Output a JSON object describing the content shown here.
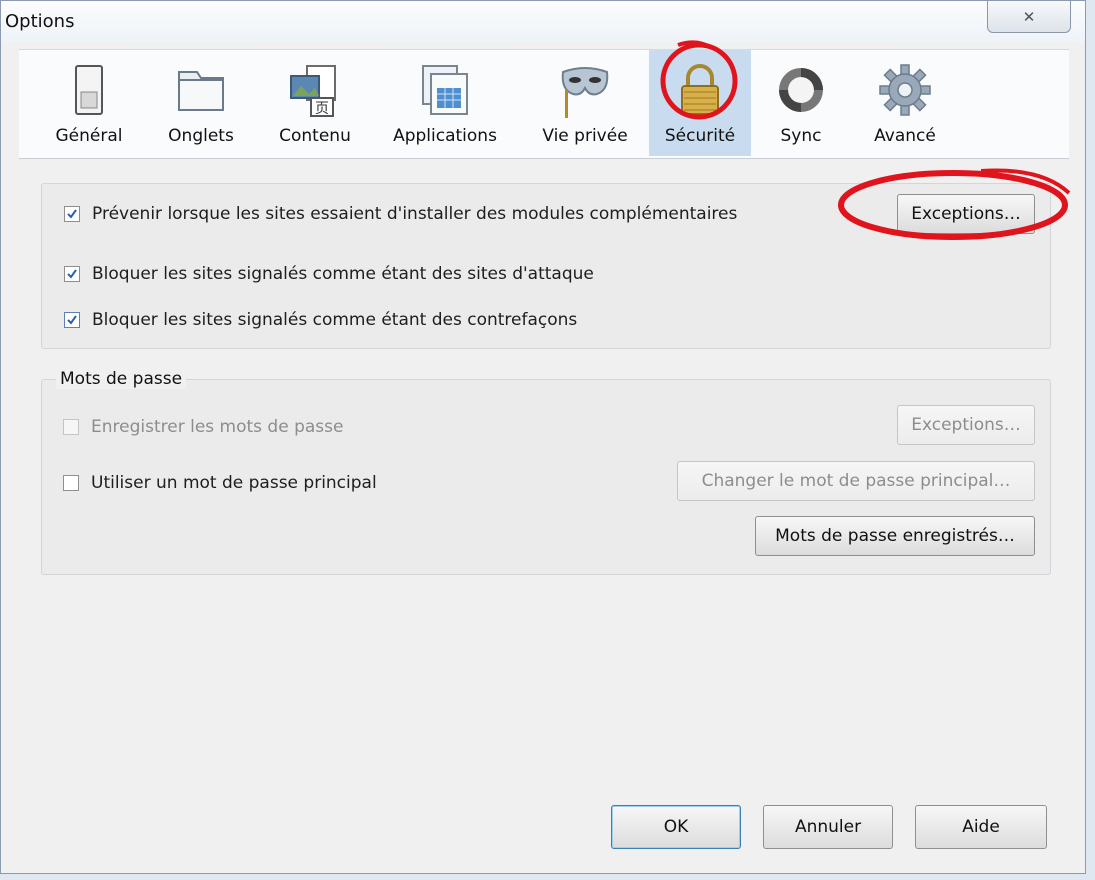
{
  "window": {
    "title": "Options",
    "close_glyph": "✕"
  },
  "tabs": [
    {
      "id": "general",
      "label": "Général",
      "icon": "switch-icon"
    },
    {
      "id": "tabs",
      "label": "Onglets",
      "icon": "folder-tab-icon"
    },
    {
      "id": "content",
      "label": "Contenu",
      "icon": "content-page-icon"
    },
    {
      "id": "applications",
      "label": "Applications",
      "icon": "applications-window-icon"
    },
    {
      "id": "privacy",
      "label": "Vie privée",
      "icon": "mask-icon"
    },
    {
      "id": "security",
      "label": "Sécurité",
      "icon": "padlock-icon",
      "active": true
    },
    {
      "id": "sync",
      "label": "Sync",
      "icon": "sync-icon"
    },
    {
      "id": "advanced",
      "label": "Avancé",
      "icon": "gear-icon"
    }
  ],
  "addons": {
    "warn_label": "Prévenir lorsque les sites essaient d'installer des modules complémentaires",
    "warn_checked": true,
    "exceptions_button": "Exceptions…",
    "block_attack_label": "Bloquer les sites signalés comme étant des sites d'attaque",
    "block_attack_checked": true,
    "block_forgery_label": "Bloquer les sites signalés comme étant des contrefaçons",
    "block_forgery_checked": true
  },
  "passwords": {
    "group_label": "Mots de passe",
    "remember_label": "Enregistrer les mots de passe",
    "remember_checked": false,
    "remember_disabled": true,
    "exceptions_button": "Exceptions…",
    "master_label": "Utiliser un mot de passe principal",
    "master_checked": false,
    "change_master_button": "Changer le mot de passe principal…",
    "saved_passwords_button": "Mots de passe enregistrés…"
  },
  "footer": {
    "ok": "OK",
    "cancel": "Annuler",
    "help": "Aide"
  },
  "colors": {
    "annotation_red": "#e0141c",
    "active_tab": "#c9dcef",
    "check_blue": "#2a5fb0"
  }
}
